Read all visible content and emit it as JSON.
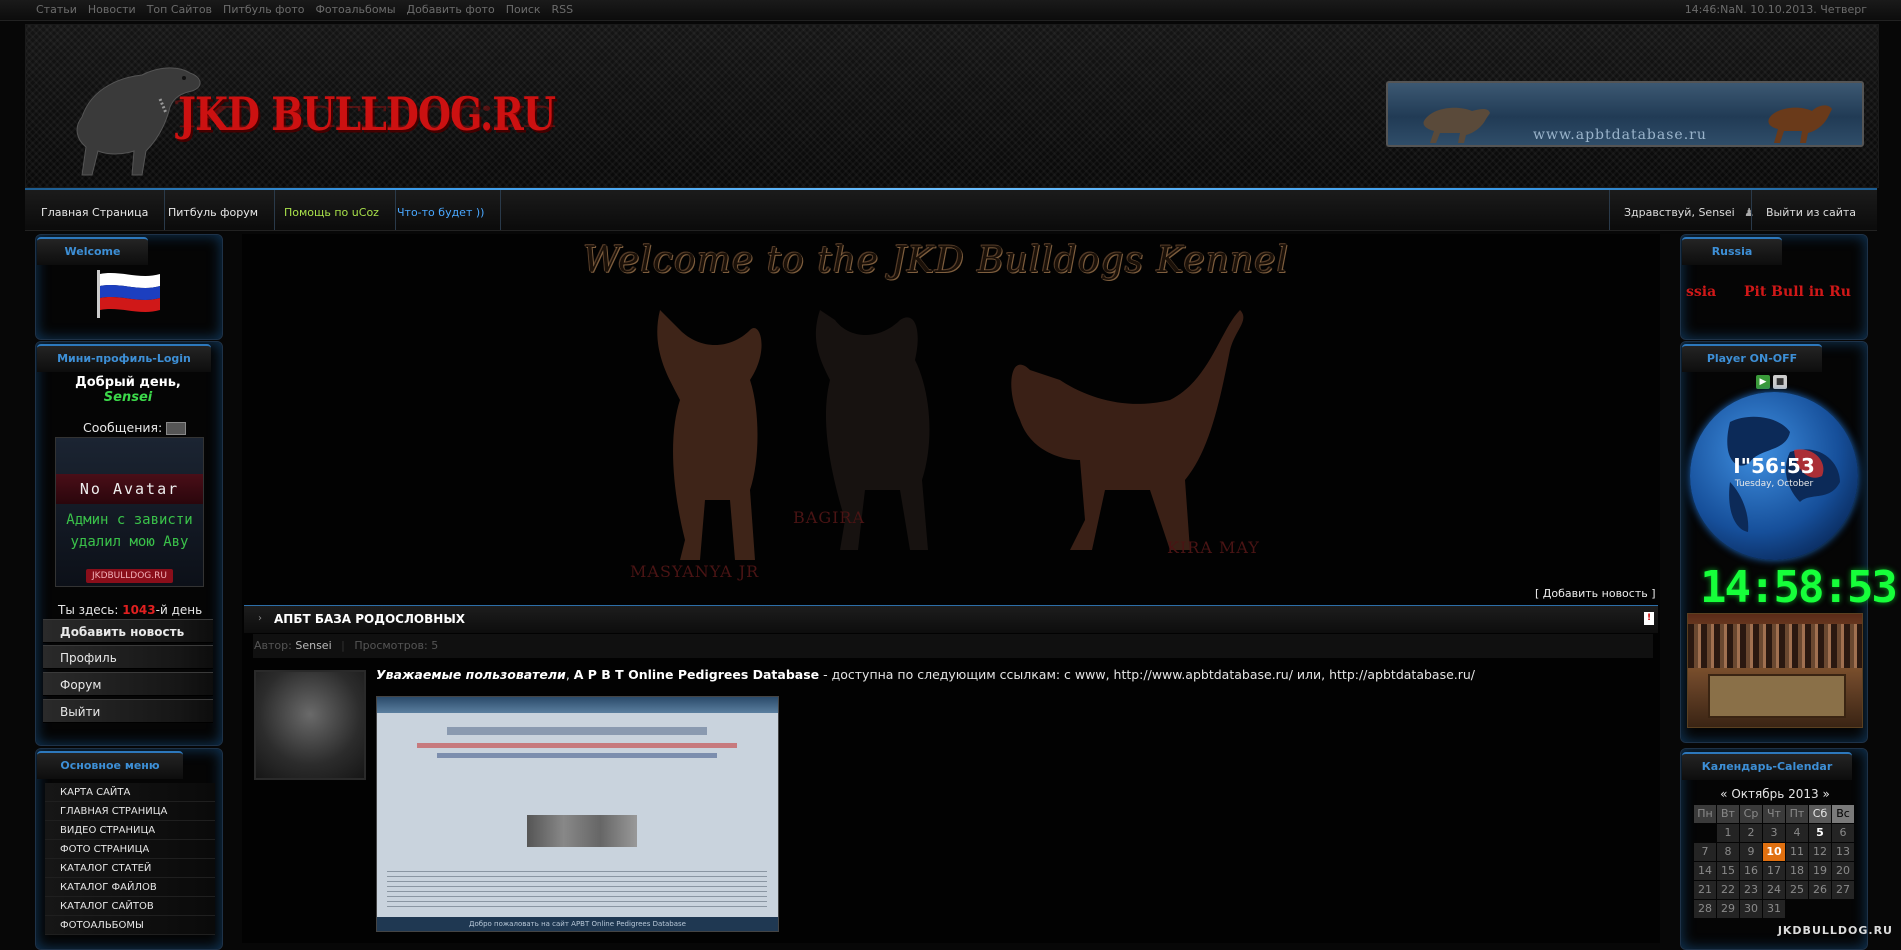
{
  "top_nav": [
    "Статьи",
    "Новости",
    "Топ Сайтов",
    "Питбуль фото",
    "Фотоальбомы",
    "Добавить фото",
    "Поиск",
    "RSS"
  ],
  "top_datetime": "14:46:NaN. 10.10.2013. Четверг",
  "site_logo": "JKD BULLDOG.RU",
  "banner_url": "www.apbtdatabase.ru",
  "main_nav": {
    "home": "Главная Страница",
    "forum": "Питбуль форум",
    "help": "Помощь по uCoz",
    "soon": "Что-то будет ))",
    "greeting": "Здравствуй, Sensei",
    "logout": "Выйти из сайта"
  },
  "colors": {
    "accent_blue": "#3d8fd6",
    "logo_red": "#cc1111",
    "digital_green": "#16ff3a",
    "today_orange": "#e07010"
  },
  "left": {
    "welcome_header": "Welcome",
    "login_header": "Мини-профиль-Login",
    "good_day": "Добрый день,",
    "username": "Sensei",
    "messages_label": "Сообщения:",
    "avatar_title": "No Avatar",
    "avatar_line1": "Админ с зависти",
    "avatar_line2": "удалил мою Аву",
    "avatar_site": "JKDBULLDOG.RU",
    "visit_prefix": "Ты здесь: ",
    "visit_days": "1043",
    "visit_suffix": "-й день",
    "profile_menu": [
      "Добавить новость",
      "Профиль",
      "Форум",
      "Выйти"
    ],
    "main_menu_header": "Основное меню",
    "main_menu": [
      "КАРТА САЙТА",
      "ГЛАВНАЯ СТРАНИЦА",
      "ВИДЕО СТРАНИЦА",
      "ФОТО СТРАНИЦА",
      "КАТАЛОГ СТАТЕЙ",
      "КАТАЛОГ ФАЙЛОВ",
      "КАТАЛОГ САЙТОВ",
      "ФОТОАЛЬБОМЫ"
    ]
  },
  "center": {
    "welcome_title": "Welcome to the JKD Bulldogs Kennel",
    "dog_names": [
      "MASYANYA JR",
      "BAGIRA",
      "KIRA MAY"
    ],
    "add_news": "[ Добавить новость ]",
    "news": {
      "title": "АПБТ БАЗА РОДОСЛОВНЫХ",
      "author_label": "Автор:",
      "author": "Sensei",
      "views_label": "Просмотров:",
      "views": "5",
      "text_italic": "Уважаемые пользователи",
      "text_bold": "A P B T Online Pedigrees Database",
      "text_rest": " - доступна по следующим ссылкам: с www, http://www.apbtdatabase.ru/  или,  http://apbtdatabase.ru/",
      "screenshot_footer": "Добро пожаловать на сайт APBT Online Pedigrees Database"
    }
  },
  "right": {
    "russia_header": "Russia",
    "marquee_left": "ssia",
    "marquee_right": "Pit Bull in Ru",
    "player_header": "Player ON-OFF",
    "globe_time": "I\"56:53",
    "globe_date": "Tuesday, October",
    "digital_clock": "14:58:53",
    "calendar_header": "Календарь-Calendar",
    "calendar_month": "«  Октябрь 2013  »",
    "weekdays": [
      "Пн",
      "Вт",
      "Ср",
      "Чт",
      "Пт",
      "Сб",
      "Вс"
    ],
    "days": [
      "",
      "1",
      "2",
      "3",
      "4",
      "5",
      "6",
      "7",
      "8",
      "9",
      "10",
      "11",
      "12",
      "13",
      "14",
      "15",
      "16",
      "17",
      "18",
      "19",
      "20",
      "21",
      "22",
      "23",
      "24",
      "25",
      "26",
      "27",
      "28",
      "29",
      "30",
      "31"
    ],
    "today": "10"
  },
  "footer_mark": "JKDBULLDOG.RU"
}
